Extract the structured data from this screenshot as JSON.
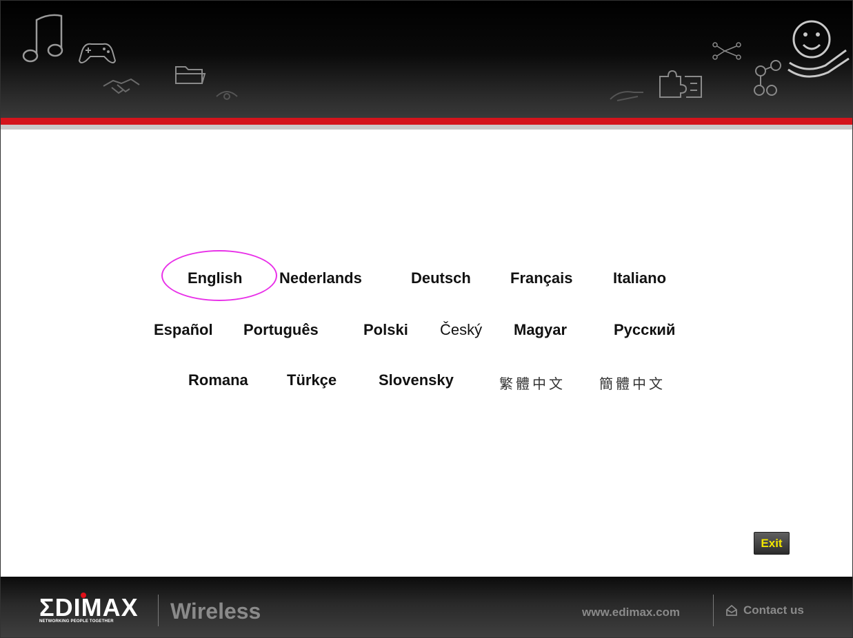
{
  "languages": {
    "row1": [
      "English",
      "Nederlands",
      "Deutsch",
      "Français",
      "Italiano"
    ],
    "row2": [
      "Español",
      "Português",
      "Polski",
      "Český",
      "Magyar",
      "Pyccкий"
    ],
    "row3": [
      "Romana",
      "Türkçe",
      "Slovensky",
      "繁體中文",
      "簡體中文"
    ]
  },
  "exit_label": "Exit",
  "footer": {
    "logo": "ΣDIMAX",
    "logo_tagline": "NETWORKING PEOPLE TOGETHER",
    "product": "Wireless",
    "url": "www.edimax.com",
    "contact_label": "Contact us"
  },
  "colors": {
    "accent_red": "#d4141c",
    "highlight_ellipse": "#e830e8",
    "exit_text": "#f2e600"
  },
  "header_icons": [
    "music-icon",
    "gamepad-icon",
    "handshake-icon",
    "folder-icon",
    "eye-icon",
    "hand-icon",
    "puzzle-icon",
    "network-icon",
    "molecule-icon",
    "smiley-hand-icon"
  ]
}
